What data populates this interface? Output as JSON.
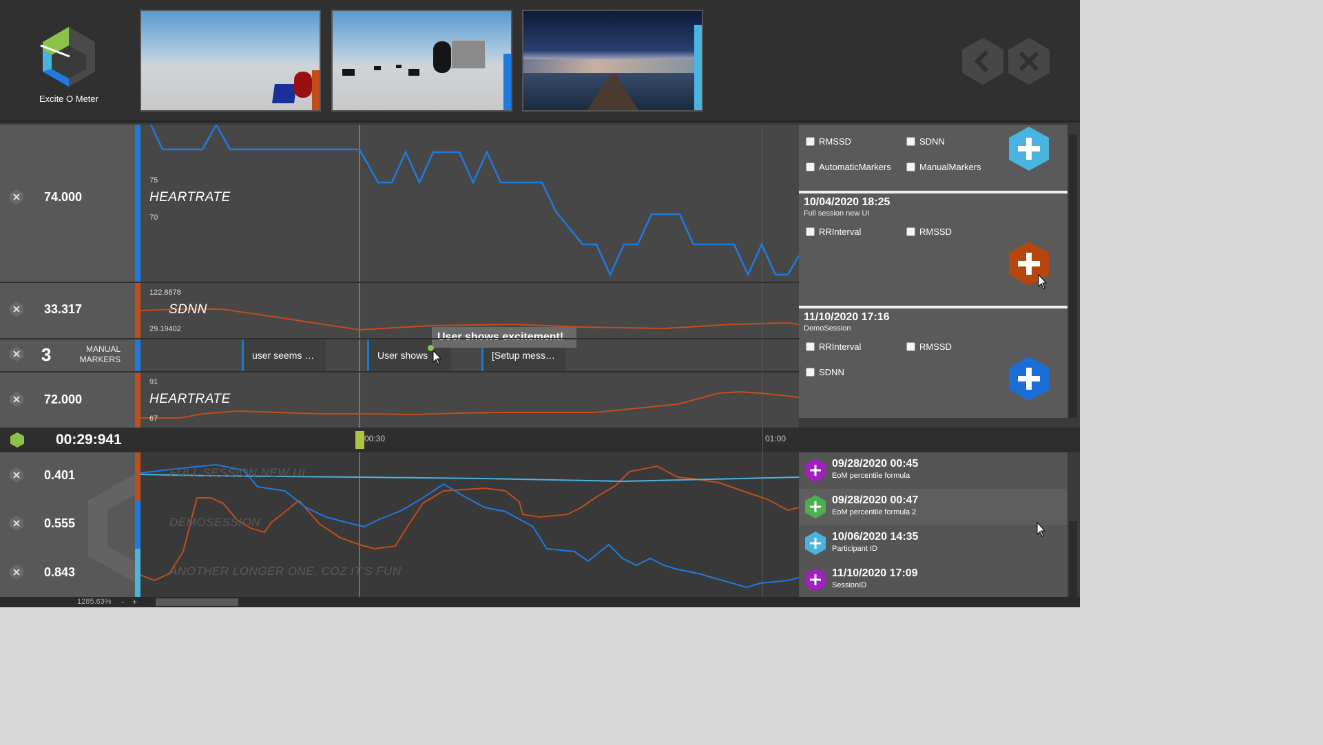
{
  "app": {
    "title": "Excite O Meter"
  },
  "colors": {
    "blue": "#1f7be0",
    "orange": "#c24e1c",
    "lightblue": "#4ab4e0",
    "green": "#8bc34a",
    "purple": "#a020c0",
    "addgreen": "#4caf50"
  },
  "tracks": [
    {
      "value": "74.000",
      "name": "HEARTRATE",
      "tick_top": "75",
      "tick_bottom": "70",
      "color": "#1f7be0"
    },
    {
      "value": "33.317",
      "name": "SDNN",
      "tick_top": "122.8878",
      "tick_bottom": "29.19402",
      "color": "#c24e1c"
    },
    {
      "value": "72.000",
      "name": "HEARTRATE",
      "tick_top": "91",
      "tick_bottom": "67",
      "color": "#c24e1c"
    }
  ],
  "markers": {
    "count": "3",
    "label_line1": "MANUAL",
    "label_line2": "MARKERS",
    "items": [
      "user seems …",
      "User shows",
      "[Setup mess…"
    ],
    "tooltip": "User shows excitement!"
  },
  "timeline": {
    "current": "00:29:941",
    "tick1": "00:30",
    "tick2": "01:00"
  },
  "sessions": [
    {
      "date": "",
      "desc": "",
      "checks": [
        "RMSSD",
        "SDNN",
        "AutomaticMarkers",
        "ManualMarkers"
      ],
      "color": "#4ab4e0"
    },
    {
      "date": "10/04/2020 18:25",
      "desc": "Full session new UI",
      "checks": [
        "RRInterval",
        "RMSSD"
      ],
      "color": "#b4460e"
    },
    {
      "date": "11/10/2020 17:16",
      "desc": "DemoSession",
      "checks": [
        "RRInterval",
        "RMSSD",
        "SDNN"
      ],
      "color": "#1a6ed8"
    }
  ],
  "compare": {
    "values": [
      "0.401",
      "0.555",
      "0.843"
    ],
    "labels": [
      "FULL SESSION NEW UI",
      "DEMOSESSION",
      "ANOTHER LONGER ONE, COZ IT'S FUN"
    ]
  },
  "formulas": [
    {
      "date": "09/28/2020 00:45",
      "desc": "EoM percentile formula",
      "color": "#a020c0"
    },
    {
      "date": "09/28/2020 00:47",
      "desc": "EoM percentile formula 2",
      "color": "#4caf50"
    },
    {
      "date": "10/06/2020 14:35",
      "desc": "Participant ID",
      "color": "#4ab4e0"
    },
    {
      "date": "11/10/2020 17:09",
      "desc": "SessionID",
      "color": "#a020c0"
    }
  ],
  "status": {
    "zoom": "1285.63%",
    "minus": "-",
    "plus": "+"
  }
}
